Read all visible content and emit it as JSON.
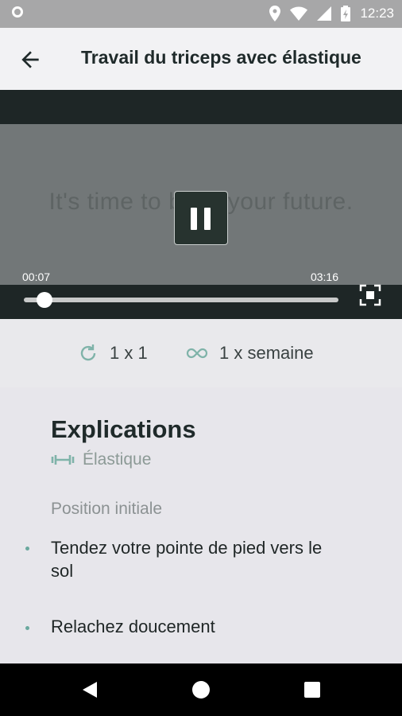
{
  "status_bar": {
    "time": "12:23"
  },
  "app_bar": {
    "title": "Travail du triceps avec élastique"
  },
  "video": {
    "overlay_text": "It's time to build your future.",
    "elapsed": "00:07",
    "duration": "03:16",
    "progress": 0.036
  },
  "meta": {
    "repetitions": "1 x 1",
    "frequency": "1 x semaine"
  },
  "explanations": {
    "heading": "Explications",
    "equipment": "Élastique",
    "subheading": "Position initiale",
    "bullets": [
      "Tendez votre pointe de pied vers le sol",
      "Relachez doucement"
    ]
  },
  "colors": {
    "accent": "#6aa89e",
    "video_bg": "#1e2626",
    "title_text": "#1f2a2a"
  }
}
